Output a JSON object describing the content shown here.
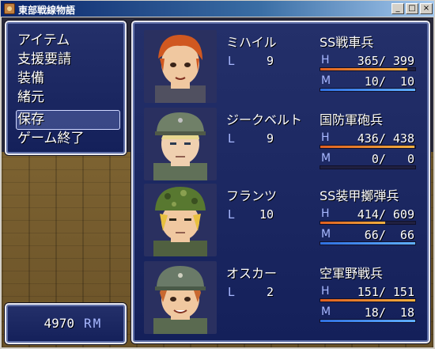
{
  "window": {
    "title": "東部戦線物語",
    "minimize_label": "_",
    "maximize_label": "□",
    "close_label": "×"
  },
  "menu": {
    "items": [
      {
        "label": "アイテム"
      },
      {
        "label": "支援要請"
      },
      {
        "label": "装備"
      },
      {
        "label": "緒元"
      },
      {
        "label": "保存"
      },
      {
        "label": "ゲーム終了"
      }
    ],
    "selected_index": 4
  },
  "gold": {
    "value": "4970",
    "unit": "RM"
  },
  "stat_labels": {
    "level": "L",
    "hp": "H",
    "mp": "M"
  },
  "party": [
    {
      "name": "ミハイル",
      "level": "9",
      "class": "SS戦車兵",
      "hp": {
        "text": "365/ 399",
        "cur": 365,
        "max": 399
      },
      "mp": {
        "text": "10/  10",
        "cur": 10,
        "max": 10
      },
      "portrait": {
        "hair": "#d05820",
        "skin": "#f0c8a0",
        "cap": "none",
        "uniform": "#505060"
      }
    },
    {
      "name": "ジークベルト",
      "level": "9",
      "class": "国防軍砲兵",
      "hp": {
        "text": "436/ 438",
        "cur": 436,
        "max": 438
      },
      "mp": {
        "text": "0/   0",
        "cur": 0,
        "max": 0
      },
      "portrait": {
        "hair": "#e8d890",
        "skin": "#f0d0b0",
        "cap": "#708068",
        "uniform": "#607058"
      }
    },
    {
      "name": "フランツ",
      "level": "10",
      "class": "SS装甲擲弾兵",
      "hp": {
        "text": "414/ 609",
        "cur": 414,
        "max": 609
      },
      "mp": {
        "text": "66/  66",
        "cur": 66,
        "max": 66
      },
      "portrait": {
        "hair": "#e8c040",
        "skin": "#f0c8a0",
        "cap": "#587830",
        "uniform": "#506040"
      }
    },
    {
      "name": "オスカー",
      "level": "2",
      "class": "空軍野戦兵",
      "hp": {
        "text": "151/ 151",
        "cur": 151,
        "max": 151
      },
      "mp": {
        "text": "18/  18",
        "cur": 18,
        "max": 18
      },
      "portrait": {
        "hair": "#c86830",
        "skin": "#f0c8a0",
        "cap": "#6a7a68",
        "uniform": "#5a6a50"
      }
    }
  ]
}
